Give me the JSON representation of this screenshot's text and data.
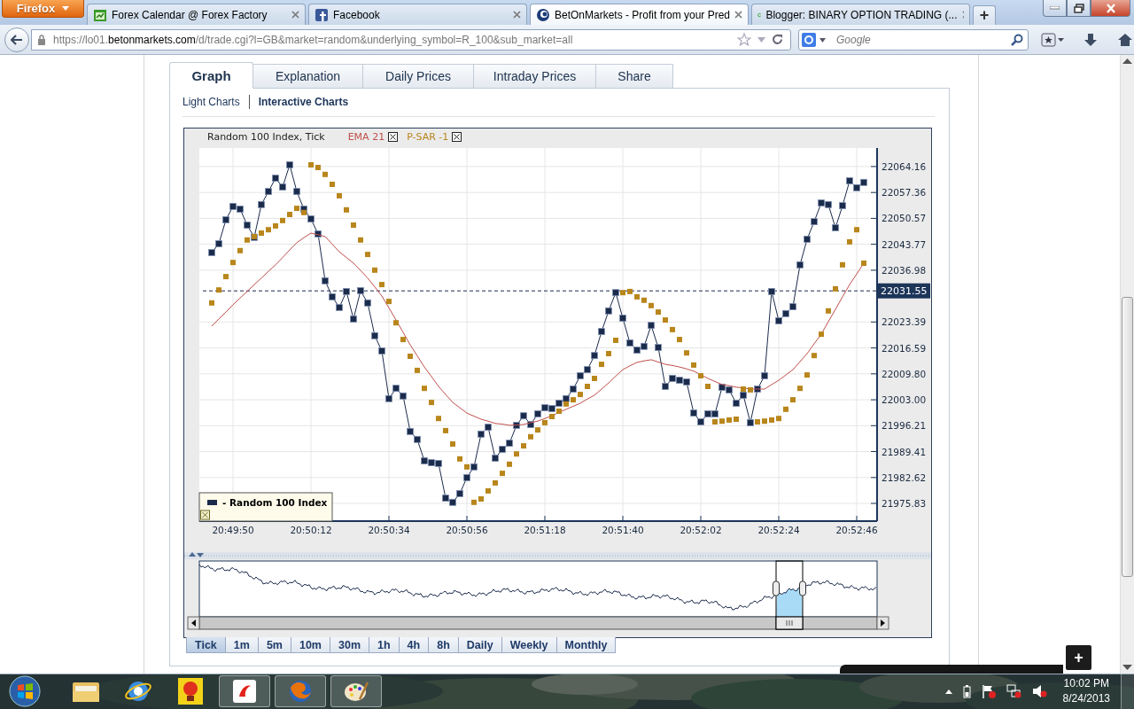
{
  "browser": {
    "menu_button": "Firefox",
    "tabs": [
      {
        "title": "Forex Calendar @ Forex Factory",
        "selected": false
      },
      {
        "title": "Facebook",
        "selected": false
      },
      {
        "title": "BetOnMarkets - Profit from your Pred",
        "selected": true
      },
      {
        "title": "Blogger: BINARY OPTION TRADING (...",
        "selected": false
      }
    ],
    "new_tab": "+",
    "address": "https://lo01.**betonmarkets.com**/d/trade.cgi?l=GB&market=random&underlying_symbol=R_100&sub_market=all",
    "search": {
      "placeholder": "Google"
    }
  },
  "page": {
    "tabs": [
      {
        "label": "Graph",
        "selected": true
      },
      {
        "label": "Explanation",
        "selected": false
      },
      {
        "label": "Daily Prices",
        "selected": false
      },
      {
        "label": "Intraday Prices",
        "selected": false
      },
      {
        "label": "Share",
        "selected": false
      }
    ],
    "chart_types": [
      {
        "label": "Light Charts",
        "selected": false
      },
      {
        "label": "Interactive Charts",
        "selected": true
      }
    ],
    "chart": {
      "legend_separator": "-",
      "chart_data": {
        "type": "line",
        "title": "Random 100 Index, Tick",
        "categories": [
          null,
          null,
          null,
          "20:49:50",
          null,
          null,
          null,
          null,
          null,
          null,
          null,
          null,
          null,
          null,
          "20:50:12",
          null,
          null,
          null,
          null,
          null,
          null,
          null,
          null,
          null,
          null,
          "20:50:34",
          null,
          null,
          null,
          null,
          null,
          null,
          null,
          null,
          null,
          null,
          "20:50:56",
          null,
          null,
          null,
          null,
          null,
          null,
          null,
          null,
          null,
          null,
          "20:51:18",
          null,
          null,
          null,
          null,
          null,
          null,
          null,
          null,
          null,
          null,
          "20:51:40",
          null,
          null,
          null,
          null,
          null,
          null,
          null,
          null,
          null,
          null,
          "20:52:02",
          null,
          null,
          null,
          null,
          null,
          null,
          null,
          null,
          null,
          null,
          "20:52:24",
          null,
          null,
          null,
          null,
          null,
          null,
          null,
          null,
          null,
          null,
          "20:52:46",
          null
        ],
        "series": [
          {
            "name": "Random 100 Index",
            "marker": "square",
            "color": "#1b2b4b",
            "values": [
              22041.6,
              22043.9,
              22050.2,
              22053.7,
              22053.0,
              22048.8,
              22045.6,
              22054.2,
              22057.6,
              22061.1,
              22058.8,
              22064.6,
              22057.6,
              22053.0,
              22050.4,
              22046.5,
              22034.2,
              22030.0,
              22027.2,
              22031.4,
              22024.2,
              22031.6,
              22028.4,
              22019.8,
              22015.8,
              22003.3,
              22006.0,
              22004.0,
              21994.7,
              21992.6,
              21987.0,
              21986.5,
              21986.3,
              21977.2,
              21976.1,
              21978.4,
              21982.6,
              21985.4,
              21994.0,
              21995.8,
              21987.7,
              21990.0,
              21991.6,
              21996.3,
              21998.8,
              21996.5,
              21999.3,
              22000.9,
              22000.7,
              22002.1,
              22003.3,
              22005.8,
              22009.3,
              22010.9,
              22014.6,
              22020.9,
              22026.3,
              22031.1,
              22024.4,
              22017.9,
              22016.0,
              22017.0,
              22022.5,
              22016.7,
              22006.5,
              22008.6,
              22008.1,
              22007.7,
              21999.5,
              21997.2,
              21999.3,
              21999.3,
              22006.3,
              22005.6,
              22002.1,
              22004.2,
              21997.0,
              22005.8,
              22009.3,
              22031.4,
              22023.7,
              22025.6,
              22027.4,
              22038.4,
              22045.1,
              22049.7,
              22054.6,
              22054.2,
              22048.1,
              22053.9,
              22060.4,
              22058.6,
              22060.0
            ]
          },
          {
            "name": "EMA 21",
            "color": "#c0504d",
            "values": [
              22022.3,
              22024.2,
              22026.0,
              22027.9,
              22029.7,
              22031.4,
              22033.2,
              22034.9,
              22036.7,
              22038.4,
              22040.3,
              22042.3,
              22044.2,
              22045.5,
              22046.7,
              22046.3,
              22045.8,
              22043.8,
              22041.8,
              22040.3,
              22038.8,
              22036.9,
              22034.9,
              22032.6,
              22030.2,
              22027.1,
              22023.9,
              22020.7,
              22017.4,
              22014.5,
              22011.6,
              22009.1,
              22006.5,
              22004.4,
              22002.3,
              22000.9,
              21999.5,
              21998.7,
              21997.9,
              21997.4,
              21996.8,
              21996.6,
              21996.3,
              21996.4,
              21996.5,
              21997.0,
              21997.4,
              21998.1,
              21998.8,
              21999.7,
              22000.5,
              22001.3,
              22002.1,
              22003.2,
              22004.2,
              22005.8,
              22007.4,
              22009.2,
              22010.9,
              22011.9,
              22012.8,
              22013.2,
              22013.5,
              22012.9,
              22012.3,
              22012.0,
              22011.6,
              22011.1,
              22010.5,
              22009.6,
              22008.6,
              22007.8,
              22007.0,
              22006.7,
              22006.3,
              22006.1,
              22005.8,
              22005.8,
              22005.8,
              22007.0,
              22008.1,
              22009.5,
              22010.9,
              22013.0,
              22015.1,
              22017.7,
              22020.2,
              22023.5,
              22026.7,
              22030.0,
              22033.2,
              22036.0,
              22038.8
            ]
          },
          {
            "name": "P-SAR -1",
            "type": "scatter",
            "marker": "square",
            "color": "#b8861b",
            "values": [
              22028.4,
              22031.8,
              22035.3,
              22039.0,
              22042.1,
              22044.9,
              22045.8,
              22046.7,
              22047.6,
              22048.6,
              22050.0,
              22051.6,
              22053.2,
              22052.1,
              22064.6,
              22063.9,
              22062.1,
              22059.5,
              22056.5,
              22052.8,
              22048.8,
              22044.9,
              22041.1,
              22037.0,
              22033.2,
              22028.8,
              22023.2,
              22018.8,
              22014.4,
              22010.7,
              22006.0,
              22002.3,
              21998.1,
              21994.9,
              21991.4,
              21987.5,
              21985.4,
              21976.1,
              21977.0,
              21979.1,
              21981.2,
              21983.7,
              21986.1,
              21988.8,
              21990.9,
              21993.3,
              21995.1,
              21997.0,
              21998.6,
              22000.0,
              22001.9,
              22003.0,
              22004.4,
              22006.5,
              22008.6,
              22012.3,
              22015.1,
              22018.6,
              22031.1,
              22031.4,
              22030.0,
              22029.1,
              22027.7,
              22026.0,
              22023.9,
              22021.4,
              22018.8,
              22015.3,
              22012.1,
              22009.3,
              22006.5,
              21997.2,
              21997.4,
              21997.7,
              21997.9,
              22005.8,
              22005.6,
              21997.2,
              21997.4,
              21997.7,
              21998.1,
              22000.5,
              22003.0,
              22006.0,
              22009.5,
              22014.6,
              22020.2,
              22026.3,
              22032.1,
              22038.4,
              22044.4,
              22047.6,
              22038.8
            ]
          }
        ],
        "ylim": [
          21971.18,
          22069.02
        ],
        "yticks": [
          {
            "value": 22064.16,
            "label": "22064.16"
          },
          {
            "value": 22057.365,
            "label": "22057.36"
          },
          {
            "value": 22050.57,
            "label": "22050.57"
          },
          {
            "value": 22043.775,
            "label": "22043.77"
          },
          {
            "value": 22036.98,
            "label": "22036.98"
          },
          {
            "value": 22023.39,
            "label": "22023.39"
          },
          {
            "value": 22016.595,
            "label": "22016.59"
          },
          {
            "value": 22009.8,
            "label": "22009.80"
          },
          {
            "value": 22003.005,
            "label": "22003.00"
          },
          {
            "value": 21996.21,
            "label": "21996.21"
          },
          {
            "value": 21989.415,
            "label": "21989.41"
          },
          {
            "value": 21982.62,
            "label": "21982.62"
          },
          {
            "value": 21975.83,
            "label": "21975.83"
          }
        ],
        "grid": true,
        "ref_lines": [
          {
            "axis": "y",
            "value": 22031.55,
            "label": "22031.55"
          }
        ]
      }
    },
    "timeframes": [
      {
        "label": "Tick",
        "selected": true
      },
      {
        "label": "1m",
        "selected": false
      },
      {
        "label": "5m",
        "selected": false
      },
      {
        "label": "10m",
        "selected": false
      },
      {
        "label": "30m",
        "selected": false
      },
      {
        "label": "1h",
        "selected": false
      },
      {
        "label": "4h",
        "selected": false
      },
      {
        "label": "8h",
        "selected": false
      },
      {
        "label": "Daily",
        "selected": false
      },
      {
        "label": "Weekly",
        "selected": false
      },
      {
        "label": "Monthly",
        "selected": false
      }
    ]
  },
  "widget": {
    "button": "+"
  },
  "taskbar": {
    "time": "10:02 PM",
    "date": "8/24/2013"
  }
}
